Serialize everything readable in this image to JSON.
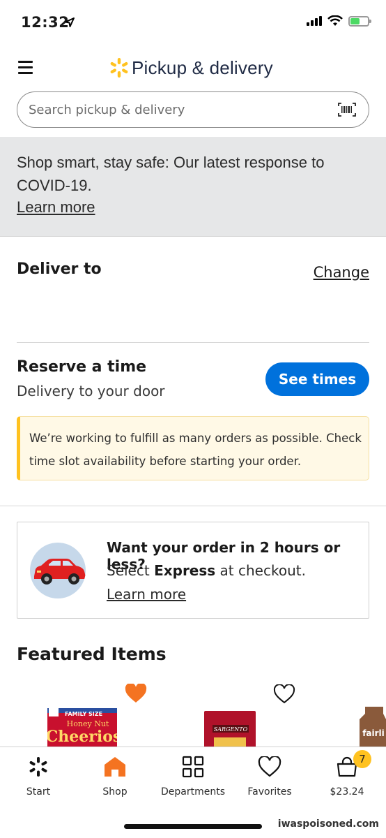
{
  "status": {
    "time": "12:32"
  },
  "header": {
    "title": "Pickup & delivery"
  },
  "search": {
    "placeholder": "Search pickup & delivery"
  },
  "covid_banner": {
    "text": "Shop smart, stay safe: Our latest response to COVID-19.",
    "link": "Learn more"
  },
  "deliver": {
    "title": "Deliver to",
    "change_label": "Change"
  },
  "reserve": {
    "title": "Reserve a time",
    "subtitle": "Delivery to your door",
    "button_label": "See times",
    "notice": "We’re working to fulfill as many orders as possible. Check time slot availability before starting your order."
  },
  "express": {
    "title": "Want your order in 2 hours or less?",
    "sub_prefix": "Select",
    "sub_bold": "Express",
    "sub_suffix": "at checkout.",
    "link": "Learn more"
  },
  "featured": {
    "title": "Featured Items",
    "products": [
      {
        "brand_line1": "FAMILY SIZE",
        "brand_line2": "Honey Nut",
        "brand_line3": "Cheerios",
        "favorited": true
      },
      {
        "brand_line1": "SARGENTO",
        "favorited": false
      },
      {
        "brand_line1": "fairli",
        "favorited": false
      }
    ]
  },
  "tabbar": {
    "tabs": [
      {
        "label": "Start"
      },
      {
        "label": "Shop"
      },
      {
        "label": "Departments"
      },
      {
        "label": "Favorites"
      },
      {
        "label": "$23.24"
      }
    ],
    "cart_count": "7"
  },
  "watermark": "iwaspoisoned.com",
  "colors": {
    "accent": "#0071dc",
    "spark": "#ffc220",
    "shop_active": "#f47321",
    "notice_bar": "#ffc220"
  }
}
